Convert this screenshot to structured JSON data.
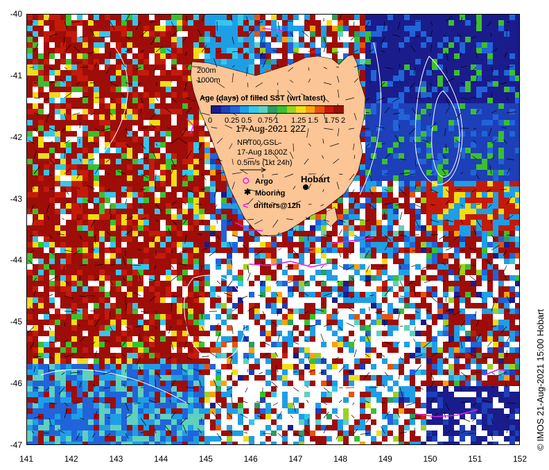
{
  "map": {
    "lon_range": [
      141,
      152
    ],
    "lat_range": [
      -47,
      -40
    ],
    "x_ticks": [
      "141",
      "142",
      "143",
      "144",
      "145",
      "146",
      "147",
      "148",
      "149",
      "150",
      "151",
      "152"
    ],
    "y_ticks": [
      "-40",
      "-41",
      "-42",
      "-43",
      "-44",
      "-45",
      "-46",
      "-47"
    ]
  },
  "legend": {
    "depth_200": "200m",
    "depth_1000": "1000m",
    "title": "Age (days) of filled SST (wrt latest)",
    "colorbar_labels": [
      "0",
      "0.25",
      "0.5",
      "0.75",
      "1",
      "1.25",
      "1.5",
      "1.75",
      "2"
    ],
    "colorbar_colors": [
      "#1a1c8c",
      "#1d3fb8",
      "#2164d9",
      "#1e9ee6",
      "#36c6ea",
      "#5fd0c0",
      "#2e9c5e",
      "#3cbf2f",
      "#9ed01f",
      "#f2dc18",
      "#f7a30f",
      "#e5540e",
      "#c41a0a",
      "#9e0d08"
    ],
    "date": "17-Aug-2021 22Z",
    "model": "NRT00 GSL",
    "model_time": "17-Aug 18:00Z",
    "arrow_scale": "0.5m/s (1kt 24h)",
    "argo_label": "Argo",
    "mooring_label": "Mooring",
    "drifters_label": "drifters@12h",
    "city": "Hobart"
  },
  "copyright": "© IMOS 21-Aug-2021 15:00 Hobart",
  "colors": {
    "land": "#fbc596",
    "cloud": "#ffffff",
    "argo": "#e81cf0",
    "drifter": "#e81cf0",
    "contour": "#ffffff"
  }
}
